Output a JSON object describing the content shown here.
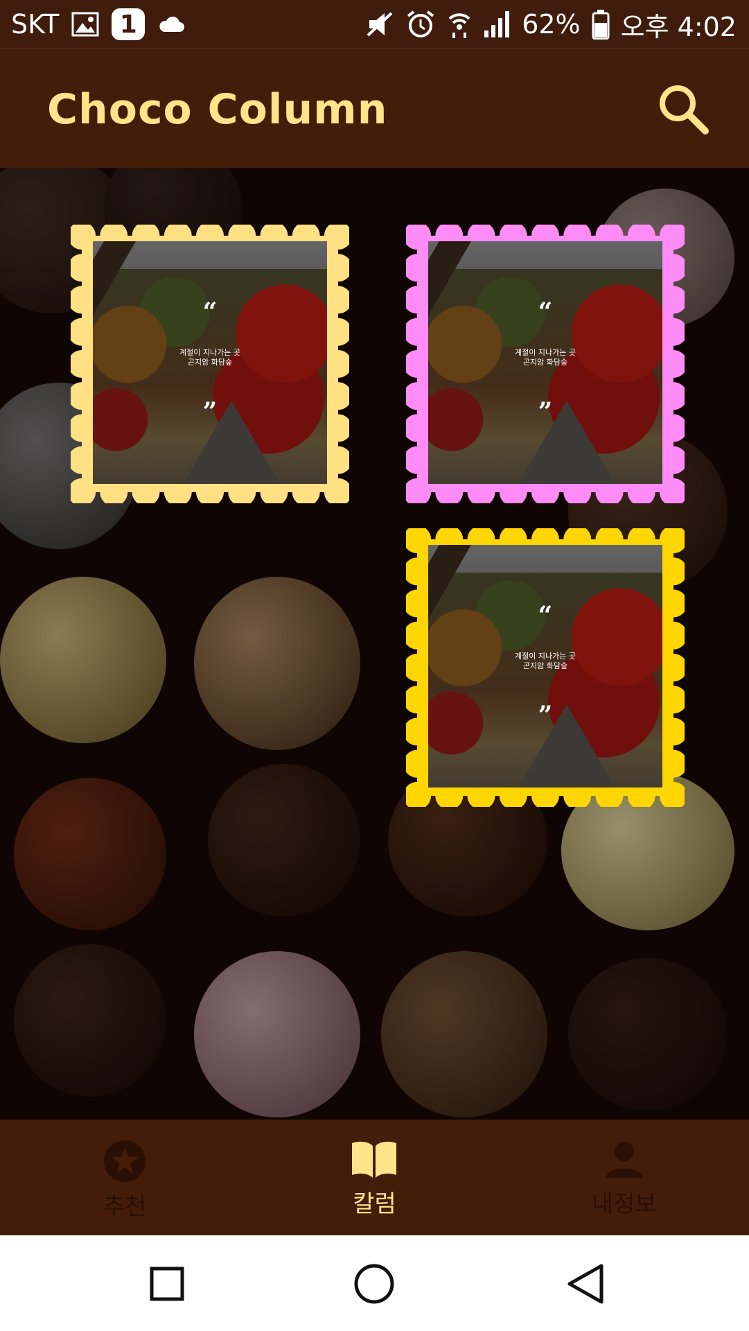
{
  "status_bar": {
    "carrier": "SKT",
    "notification_count": "1",
    "battery": "62%",
    "time": "오후 4:02",
    "icons": [
      "image-icon",
      "badge-1-icon",
      "cloud-icon",
      "mute-icon",
      "alarm-icon",
      "wifi-icon",
      "signal-icon",
      "battery-icon"
    ]
  },
  "header": {
    "title": "Choco Column",
    "search_icon": "search-icon",
    "title_color": "#ffe48a",
    "background": "#431c0a"
  },
  "columns": [
    {
      "frame_color": "#ffe083",
      "caption_line1": "계절이 지나가는 곳",
      "caption_line2": "곤지암 화담숲",
      "quote_open": "“",
      "quote_close": "”"
    },
    {
      "frame_color": "#ff8cf6",
      "caption_line1": "계절이 지나가는 곳",
      "caption_line2": "곤지암 화담숲",
      "quote_open": "“",
      "quote_close": "”"
    },
    {
      "frame_color": "#ffd600",
      "caption_line1": "계절이 지나가는 곳",
      "caption_line2": "곤지암 화담숲",
      "quote_open": "“",
      "quote_close": "”"
    }
  ],
  "bottom_nav": {
    "items": [
      {
        "label": "추천",
        "icon": "star-icon",
        "active": false
      },
      {
        "label": "칼럼",
        "icon": "book-icon",
        "active": true
      },
      {
        "label": "내정보",
        "icon": "person-icon",
        "active": false
      }
    ],
    "active_color": "#ffe48a",
    "inactive_color": "#2a0f04"
  },
  "system_nav": {
    "icons": [
      "recents-icon",
      "home-icon",
      "back-icon"
    ]
  }
}
